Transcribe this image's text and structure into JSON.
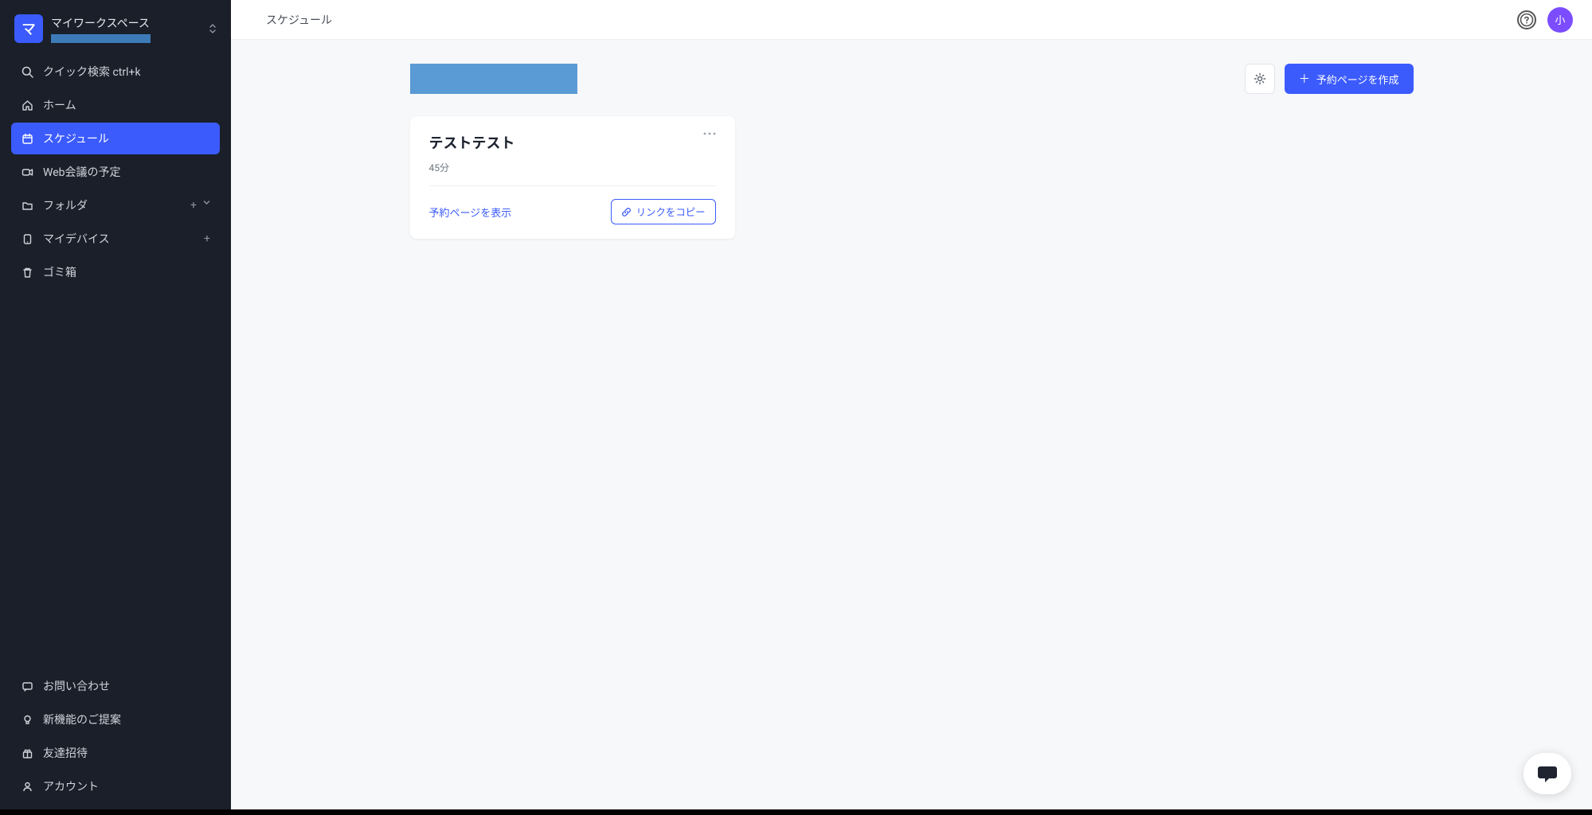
{
  "workspace": {
    "avatar_letter": "マ",
    "name": "マイワークスペース"
  },
  "sidebar": {
    "quick_search": "クイック検索 ctrl+k",
    "home": "ホーム",
    "schedule": "スケジュール",
    "web_meeting": "Web会議の予定",
    "folder": "フォルダ",
    "my_device": "マイデバイス",
    "trash": "ゴミ箱",
    "contact": "お問い合わせ",
    "feedback": "新機能のご提案",
    "invite": "友達招待",
    "account": "アカウント"
  },
  "topbar": {
    "breadcrumb": "スケジュール",
    "user_avatar_letter": "小"
  },
  "toolbar": {
    "create_button": "予約ページを作成"
  },
  "card": {
    "title": "テストテスト",
    "duration": "45分",
    "show_page": "予約ページを表示",
    "copy_link": "リンクをコピー"
  }
}
